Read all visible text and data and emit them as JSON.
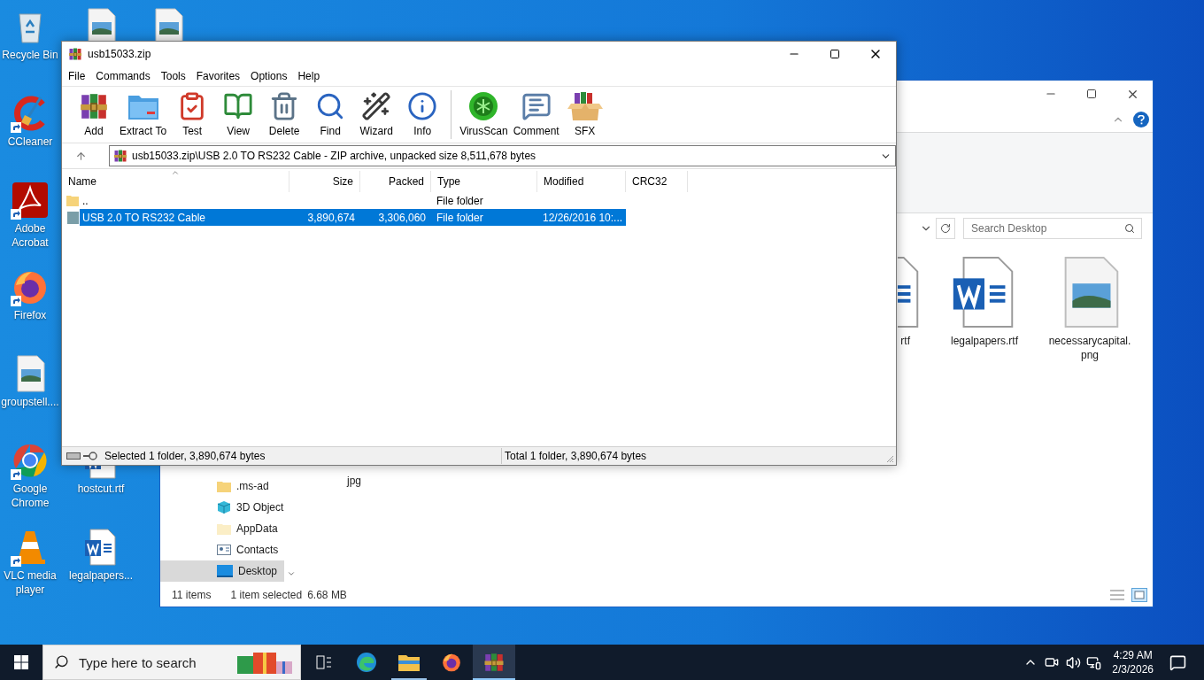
{
  "desktop": {
    "column_1": [
      {
        "label": "Recycle Bin",
        "kind": "recycle",
        "shortcut": false
      },
      {
        "label": "CCleaner",
        "kind": "ccleaner",
        "shortcut": true
      },
      {
        "label": "Adobe Acrobat",
        "kind": "acrobat",
        "shortcut": true
      },
      {
        "label": "Firefox",
        "kind": "firefox",
        "shortcut": true
      },
      {
        "label": "groupstell....",
        "kind": "image",
        "shortcut": false
      },
      {
        "label": "Google Chrome",
        "kind": "chrome",
        "shortcut": true
      },
      {
        "label": "VLC media player",
        "kind": "vlc",
        "shortcut": true
      }
    ],
    "column_2_top": [
      {
        "kind": "image"
      }
    ],
    "column_2_bottom": [
      {
        "label": "hostcut.rtf",
        "kind": "word"
      },
      {
        "label": "legalpapers...",
        "kind": "word"
      }
    ],
    "column_3_top": [
      {
        "kind": "image"
      }
    ]
  },
  "explorer": {
    "search": {
      "placeholder": "Search Desktop"
    },
    "nav_items": [
      {
        "label": ".ms-ad",
        "kind": "folder",
        "selected": false
      },
      {
        "label": "3D Object",
        "kind": "cube",
        "selected": false
      },
      {
        "label": "AppData",
        "kind": "folder_light",
        "selected": false
      },
      {
        "label": "Contacts",
        "kind": "contacts",
        "selected": false
      },
      {
        "label": "Desktop",
        "kind": "desktop",
        "selected": true
      }
    ],
    "files": [
      {
        "label": "rtf",
        "kind": "word",
        "clipped": true
      },
      {
        "label": "legalpapers.rtf",
        "kind": "word",
        "clipped": false
      },
      {
        "label": "necessarycapital.png",
        "kind": "image",
        "clipped": false
      }
    ],
    "second_row_label": "jpg",
    "status": {
      "count": "11 items",
      "selection": "1 item selected",
      "size": "6.68 MB"
    }
  },
  "winrar": {
    "title": "usb15033.zip",
    "menu": [
      "File",
      "Commands",
      "Tools",
      "Favorites",
      "Options",
      "Help"
    ],
    "toolbar": [
      {
        "label": "Add",
        "kind": "add"
      },
      {
        "label": "Extract To",
        "kind": "extract"
      },
      {
        "label": "Test",
        "kind": "test"
      },
      {
        "label": "View",
        "kind": "view"
      },
      {
        "label": "Delete",
        "kind": "delete"
      },
      {
        "label": "Find",
        "kind": "find"
      },
      {
        "label": "Wizard",
        "kind": "wizard"
      },
      {
        "label": "Info",
        "kind": "info"
      },
      {
        "kind": "separator"
      },
      {
        "label": "VirusScan",
        "kind": "virus"
      },
      {
        "label": "Comment",
        "kind": "comment"
      },
      {
        "label": "SFX",
        "kind": "sfx"
      }
    ],
    "address": "usb15033.zip\\USB 2.0 TO RS232 Cable - ZIP archive, unpacked size 8,511,678 bytes",
    "columns": [
      "Name",
      "Size",
      "Packed",
      "Type",
      "Modified",
      "CRC32"
    ],
    "rows": [
      {
        "name": "..",
        "type": "File folder",
        "kind": "parent",
        "selected": false
      },
      {
        "name": "USB 2.0 TO RS232 Cable",
        "size": "3,890,674",
        "packed": "3,306,060",
        "type": "File folder",
        "modified": "12/26/2016 10:...",
        "kind": "folder",
        "selected": true
      }
    ],
    "status_left": "Selected 1 folder, 3,890,674 bytes",
    "status_right": "Total 1 folder, 3,890,674 bytes"
  },
  "taskbar": {
    "search": {
      "placeholder": "Type here to search"
    },
    "apps": [
      {
        "kind": "taskview",
        "running": false,
        "active": false
      },
      {
        "kind": "edge",
        "running": false,
        "active": false
      },
      {
        "kind": "explorer",
        "running": true,
        "active": false
      },
      {
        "kind": "firefox",
        "running": false,
        "active": false
      },
      {
        "kind": "winrar",
        "running": true,
        "active": true
      }
    ],
    "time": "4:29 AM",
    "date": "2/3/2026"
  }
}
